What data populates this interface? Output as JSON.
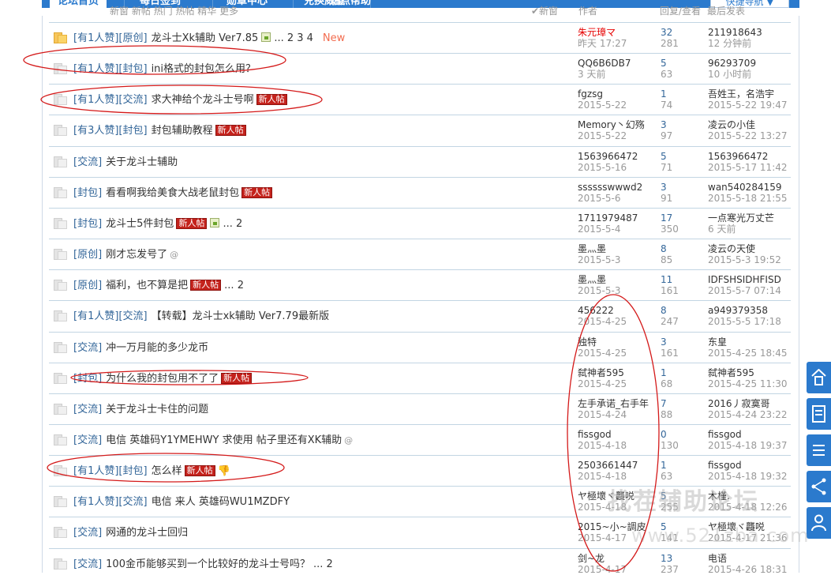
{
  "nav": {
    "tabs": [
      "论坛首页",
      "每日签到",
      "勋章中心",
      "兑换威望",
      "站点帮助"
    ],
    "quick_nav": "快捷导航 ▼"
  },
  "subbar": {
    "left": "新窗 新帖 热门 热帖 精华 更多",
    "new_window": "✔新窗",
    "col_author": "作者",
    "col_stats": "回复/查看",
    "col_last": "最后发表"
  },
  "threads": [
    {
      "icon": "hot",
      "tags": "[有1人赞][原创]",
      "subject": "龙斗士Xk辅助 Ver7.85",
      "image": true,
      "pages": "... 2 3 4",
      "page_new": "New",
      "author": "朱元璋マ",
      "author_red": true,
      "date": "昨天 17:27",
      "replies": "32",
      "views": "281",
      "last_user": "211918643",
      "last_time": "12 分钟前"
    },
    {
      "icon": "normal",
      "tags": "[有1人赞][封包]",
      "subject": "ini格式的封包怎么用？",
      "author": "QQ6B6DB7",
      "date": "3 天前",
      "replies": "5",
      "views": "63",
      "last_user": "96293709",
      "last_time": "10 小时前"
    },
    {
      "icon": "normal",
      "tags": "[有1人赞][交流]",
      "subject": "求大神给个龙斗士号啊",
      "new_badge": "新人帖",
      "author": "fgzsg",
      "date": "2015-5-22",
      "replies": "1",
      "views": "74",
      "last_user": "吾姓王，名浩宇",
      "last_time": "2015-5-22 19:47"
    },
    {
      "icon": "normal",
      "tags": "[有3人赞][封包]",
      "subject": "封包辅助教程",
      "new_badge": "新人帖",
      "author": "Memory丶幻殇",
      "date": "2015-5-22",
      "replies": "3",
      "views": "97",
      "last_user": "凌云の小佳",
      "last_time": "2015-5-22 13:27"
    },
    {
      "icon": "normal",
      "tags": "[交流]",
      "subject": "关于龙斗士辅助",
      "author": "1563966472",
      "date": "2015-5-16",
      "replies": "5",
      "views": "71",
      "last_user": "1563966472",
      "last_time": "2015-5-17 11:42"
    },
    {
      "icon": "normal",
      "tags": "[封包]",
      "subject": "看看啊我给美食大战老鼠封包",
      "new_badge": "新人帖",
      "author": "sssssswwwd2",
      "date": "2015-5-6",
      "replies": "3",
      "views": "91",
      "last_user": "wan540284159",
      "last_time": "2015-5-18 21:55"
    },
    {
      "icon": "normal",
      "tags": "[封包]",
      "subject": "龙斗士5件封包",
      "new_badge": "新人帖",
      "image": true,
      "pages": "... 2",
      "author": "1711979487",
      "date": "2015-5-4",
      "replies": "17",
      "views": "350",
      "last_user": "一点寒光万丈芒",
      "last_time": "6 天前"
    },
    {
      "icon": "normal",
      "tags": "[原创]",
      "subject": "刚才忘发号了",
      "attach": "@",
      "author": "墨灬墨",
      "date": "2015-5-3",
      "replies": "8",
      "views": "85",
      "last_user": "凌云の天使",
      "last_time": "2015-5-3 19:52"
    },
    {
      "icon": "normal",
      "tags": "[原创]",
      "subject": "福利，也不算是把",
      "new_badge": "新人帖",
      "pages": "... 2",
      "author": "墨灬墨",
      "date": "2015-5-3",
      "replies": "11",
      "views": "161",
      "last_user": "IDFSHSIDHFISD",
      "last_time": "2015-5-7 07:14"
    },
    {
      "icon": "normal",
      "tags": "[有1人赞][交流]",
      "subject": "【转载】龙斗士xk辅助 Ver7.79最新版",
      "author": "456222",
      "date": "2015-4-25",
      "replies": "8",
      "views": "247",
      "last_user": "a949379358",
      "last_time": "2015-5-5 17:18"
    },
    {
      "icon": "normal",
      "tags": "[交流]",
      "subject": "冲一万月能的多少龙币",
      "author": "独特",
      "date": "2015-4-25",
      "replies": "3",
      "views": "161",
      "last_user": "东皇",
      "last_time": "2015-4-25 18:45"
    },
    {
      "icon": "normal",
      "tags": "[封包]",
      "subject": "为什么我的封包用不了了",
      "new_badge": "新人帖",
      "author": "弑神者595",
      "date": "2015-4-25",
      "replies": "1",
      "views": "68",
      "last_user": "弑神者595",
      "last_time": "2015-4-25 11:30"
    },
    {
      "icon": "normal",
      "tags": "[交流]",
      "subject": "关于龙斗士卡住的问题",
      "author": "左手承诺_右手年",
      "date": "2015-4-24",
      "replies": "7",
      "views": "88",
      "last_user": "2016丿寂寞哥",
      "last_time": "2015-4-24 23:22"
    },
    {
      "icon": "normal",
      "tags": "[交流]",
      "subject": "电信 英雄码Y1YMEHWY 求使用 帖子里还有XK辅助",
      "attach": "@",
      "author": "fissgod",
      "date": "2015-4-18",
      "replies": "0",
      "views": "130",
      "last_user": "fissgod",
      "last_time": "2015-4-18 19:37"
    },
    {
      "icon": "normal",
      "tags": "[有1人赞][封包]",
      "subject": "怎么样",
      "new_badge": "新人帖",
      "thumb": "👎",
      "author": "2503661447",
      "date": "2015-4-18",
      "replies": "1",
      "views": "63",
      "last_user": "fissgod",
      "last_time": "2015-4-18 19:32"
    },
    {
      "icon": "normal",
      "tags": "[有1人赞][交流]",
      "subject": "电信 来人 英雄码WU1MZDFY",
      "author": "ヤ極壞ヾ龘哾",
      "date": "2015-4-18",
      "replies": "5",
      "views": "255",
      "last_user": "木槿.",
      "last_time": "2015-4-18 12:26"
    },
    {
      "icon": "normal",
      "tags": "[交流]",
      "subject": "网通的龙斗士回归",
      "author": "2015~小~調皮",
      "date": "2015-4-17",
      "replies": "5",
      "views": "141",
      "last_user": "ヤ極壞ヾ龘哾",
      "last_time": "2015-4-17 21:36"
    },
    {
      "icon": "normal",
      "tags": "[交流]",
      "subject": "100金币能够买到一个比较好的龙斗士号吗？",
      "pages": "... 2",
      "author": "剑~龙",
      "date": "2015-4-17",
      "replies": "13",
      "views": "237",
      "last_user": "电语",
      "last_time": "2015-4-26 18:31"
    }
  ],
  "sidebar": [
    "back-to-top",
    "post-thread",
    "list",
    "share",
    "user-center"
  ],
  "watermark": {
    "line1": "找茬辅助论坛",
    "line2": "www.521zba.com"
  }
}
